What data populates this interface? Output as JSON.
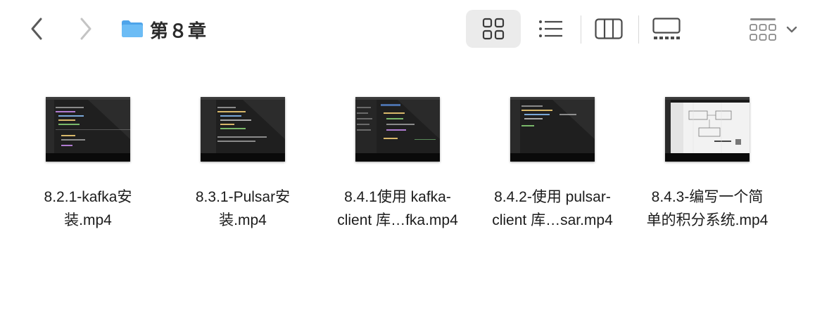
{
  "window": {
    "title": "第８章",
    "nav": {
      "back_icon": "chevron-left-icon",
      "forward_icon": "chevron-right-icon"
    },
    "folder_icon": "folder-icon",
    "folder_color": "#5aaef0"
  },
  "view_modes": [
    {
      "name": "icons",
      "icon": "grid-icon",
      "active": true
    },
    {
      "name": "list",
      "icon": "list-icon",
      "active": false
    },
    {
      "name": "columns",
      "icon": "columns-icon",
      "active": false
    },
    {
      "name": "gallery",
      "icon": "gallery-icon",
      "active": false
    }
  ],
  "group_menu": {
    "icon": "group-icon",
    "chevron": "chevron-down-icon"
  },
  "files": [
    {
      "line1": "8.2.1-kafka安",
      "line2": "装.mp4",
      "thumb_style": "dark-code"
    },
    {
      "line1": "8.3.1-Pulsar安",
      "line2": "装.mp4",
      "thumb_style": "dark-code"
    },
    {
      "line1": "8.4.1使用 kafka-",
      "line2": "client 库…fka.mp4",
      "thumb_style": "dark-ide"
    },
    {
      "line1": "8.4.2-使用 pulsar-",
      "line2": "client 库…sar.mp4",
      "thumb_style": "dark-code"
    },
    {
      "line1": "8.4.3-编写一个简",
      "line2": "单的积分系统.mp4",
      "thumb_style": "light-diagram"
    }
  ]
}
